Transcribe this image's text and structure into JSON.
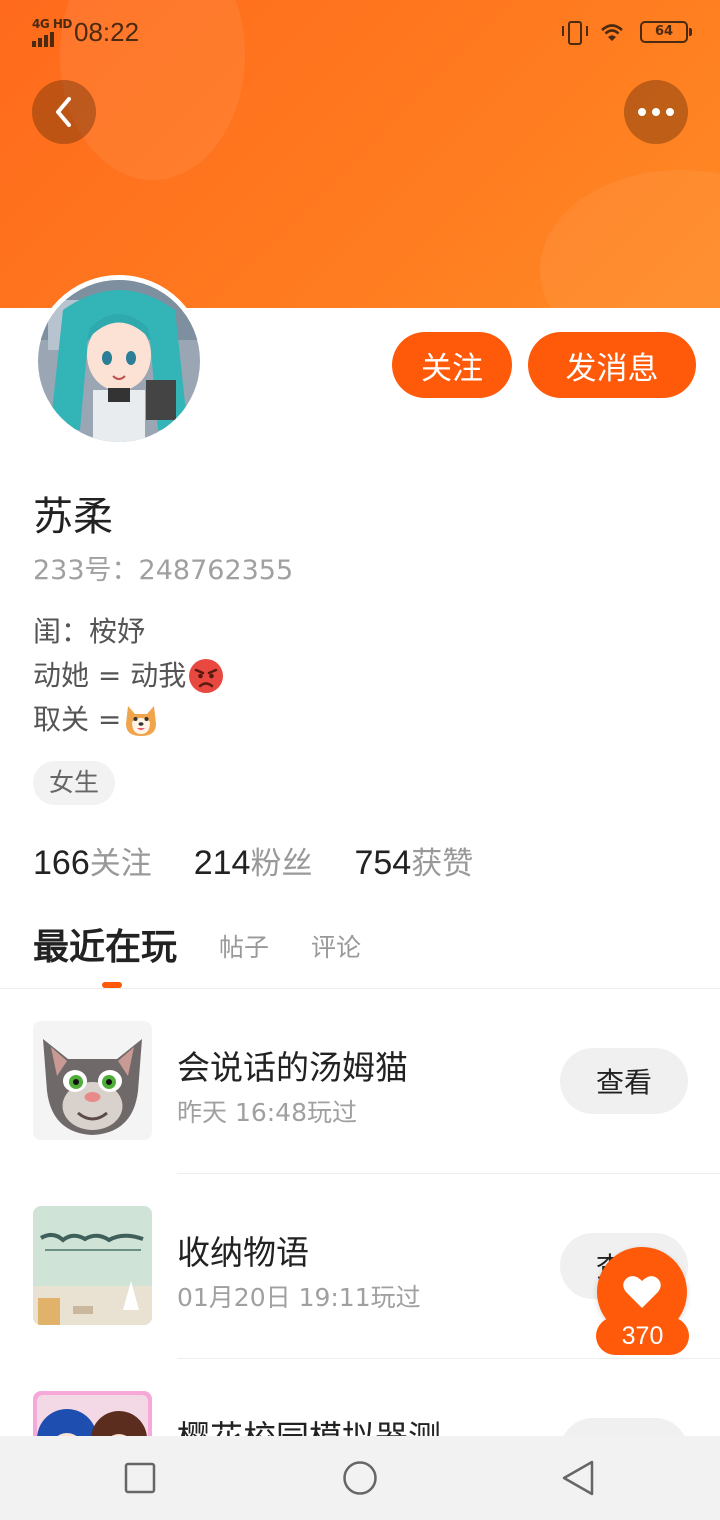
{
  "status_bar": {
    "network": "4G HD",
    "time": "08:22",
    "battery": "64"
  },
  "header": {
    "back_icon": "chevron-left-icon",
    "more_icon": "more-dots-icon"
  },
  "profile": {
    "name": "苏柔",
    "id_label": "233号：",
    "id_value": "248762355",
    "bio": {
      "line1": "闺：桉妤",
      "line2": "动她 = 动我",
      "line2_emoji": "angry-face-emoji",
      "line3": "取关 = ",
      "line3_emoji": "shiba-dog-emoji"
    },
    "tag": "女生",
    "follow_label": "关注",
    "message_label": "发消息"
  },
  "stats": [
    {
      "num": "166",
      "label": "关注"
    },
    {
      "num": "214",
      "label": "粉丝"
    },
    {
      "num": "754",
      "label": "获赞"
    }
  ],
  "tabs": [
    "最近在玩",
    "帖子",
    "评论"
  ],
  "active_tab": "最近在玩",
  "games": [
    {
      "title": "会说话的汤姆猫",
      "time": "昨天 16:48玩过",
      "button": "查看"
    },
    {
      "title": "收纳物语",
      "time": "01月20日 19:11玩过",
      "button": "查看"
    },
    {
      "title": "樱花校园模拟器测…",
      "time": "",
      "button": "查看"
    }
  ],
  "like_fab": {
    "count": "370",
    "icon": "heart-icon"
  },
  "colors": {
    "accent": "#ff5a0a",
    "banner": "#ff7a1f"
  }
}
